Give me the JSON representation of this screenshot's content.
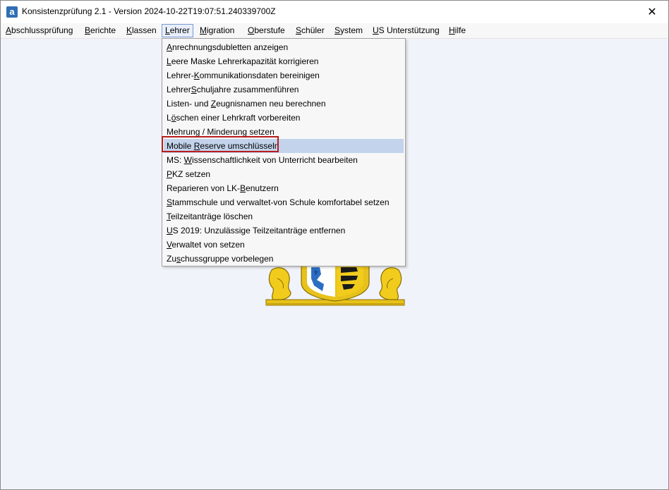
{
  "window": {
    "title": "Konsistenzprüfung 2.1 - Version 2024-10-22T19:07:51.240339700Z",
    "app_icon": "a",
    "close_glyph": "✕"
  },
  "menubar": {
    "items": [
      {
        "label": "Abschlussprüfung",
        "mnemonic": "A",
        "rest": "bschlussprüfung"
      },
      {
        "label": "Berichte",
        "mnemonic": "B",
        "rest": "erichte"
      },
      {
        "label": "Klassen",
        "mnemonic": "K",
        "rest": "lassen"
      },
      {
        "label": "Lehrer",
        "mnemonic": "L",
        "rest": "ehrer"
      },
      {
        "label": "Migration",
        "mnemonic": "M",
        "rest": "igration"
      },
      {
        "label": "Oberstufe",
        "mnemonic": "O",
        "rest": "berstufe"
      },
      {
        "label": "Schüler",
        "mnemonic": "S",
        "rest": "chüler"
      },
      {
        "label": "System",
        "mnemonic": "S",
        "rest": "ystem"
      },
      {
        "label": "US Unterstützung",
        "mnemonic": "U",
        "rest": "S Unterstützung"
      },
      {
        "label": "Hilfe",
        "mnemonic": "H",
        "rest": "ilfe"
      }
    ],
    "active": "Lehrer"
  },
  "dropdown": {
    "items": [
      {
        "pre": "",
        "mn": "A",
        "post": "nrechnungsdubletten anzeigen"
      },
      {
        "pre": "",
        "mn": "L",
        "post": "eere Maske Lehrerkapazität korrigieren"
      },
      {
        "pre": "Lehrer-",
        "mn": "K",
        "post": "ommunikationsdaten bereinigen"
      },
      {
        "pre": "Lehrer",
        "mn": "S",
        "post": "chuljahre zusammenführen"
      },
      {
        "pre": "Listen- und ",
        "mn": "Z",
        "post": "eugnisnamen neu berechnen"
      },
      {
        "pre": "L",
        "mn": "ö",
        "post": "schen einer Lehrkraft vorbereiten"
      },
      {
        "pre": "Mehrung / Minderun",
        "mn": "g",
        "post": " setzen"
      },
      {
        "pre": "Mobile ",
        "mn": "R",
        "post": "eserve umschlüsseln"
      },
      {
        "pre": "MS: ",
        "mn": "W",
        "post": "issenschaftlichkeit von Unterricht bearbeiten"
      },
      {
        "pre": "",
        "mn": "P",
        "post": "KZ setzen"
      },
      {
        "pre": "Reparieren von LK-",
        "mn": "B",
        "post": "enutzern"
      },
      {
        "pre": "",
        "mn": "S",
        "post": "tammschule und verwaltet-von Schule komfortabel setzen"
      },
      {
        "pre": "",
        "mn": "T",
        "post": "eilzeitanträge löschen"
      },
      {
        "pre": "",
        "mn": "U",
        "post": "S 2019: Unzulässige Teilzeitanträge entfernen"
      },
      {
        "pre": "",
        "mn": "V",
        "post": "erwaltet von setzen"
      },
      {
        "pre": "Zu",
        "mn": "s",
        "post": "chussgruppe vorbelegen"
      }
    ],
    "selected_index": 7
  },
  "colors": {
    "selection": "#c3d3ec",
    "highlight_border": "#b81c1c",
    "background": "#f1f3fa"
  },
  "icons": {
    "app": "app-icon",
    "close": "close-icon",
    "emblem": "coat-of-arms-icon"
  }
}
